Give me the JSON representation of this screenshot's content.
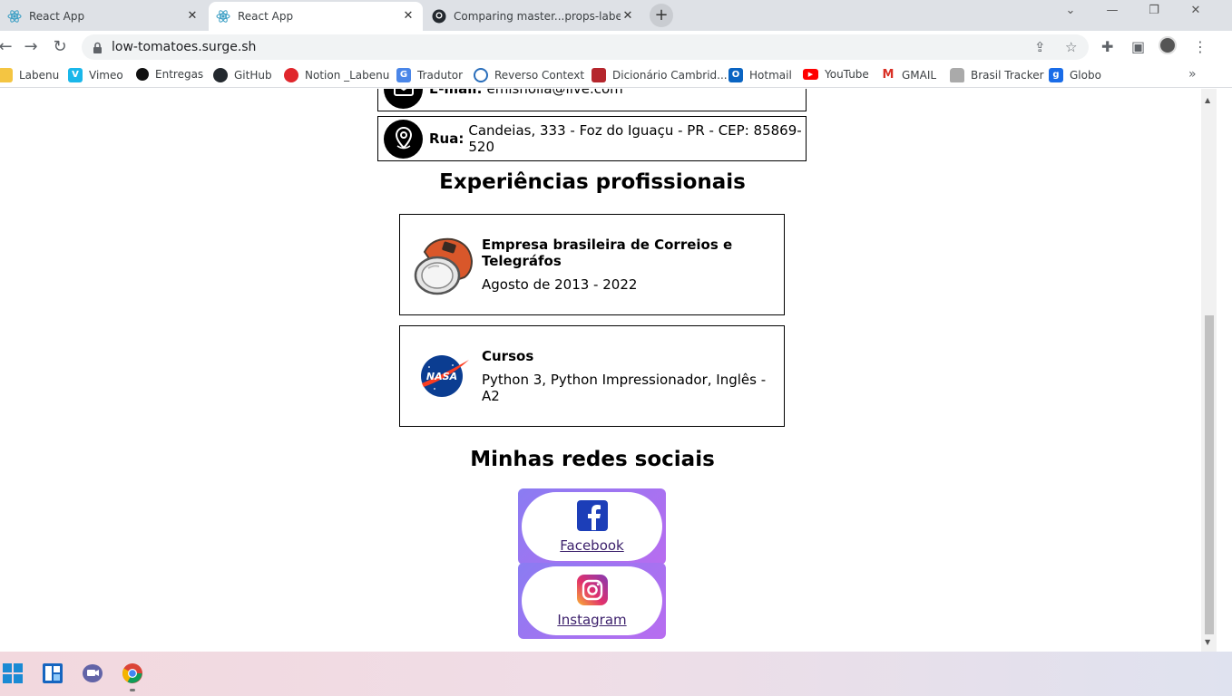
{
  "browser": {
    "tabs": [
      {
        "title": "React App",
        "active": false
      },
      {
        "title": "React App",
        "active": true
      },
      {
        "title": "Comparing master...props-labedi",
        "active": false
      }
    ],
    "url": "low-tomatoes.surge.sh",
    "bookmarks": [
      {
        "label": "Labenu",
        "icon": "folder-icon"
      },
      {
        "label": "Vimeo",
        "icon": "vimeo-icon"
      },
      {
        "label": "Entregas",
        "icon": "circle-icon"
      },
      {
        "label": "GitHub",
        "icon": "github-icon"
      },
      {
        "label": "Notion _Labenu",
        "icon": "apple-icon"
      },
      {
        "label": "Tradutor",
        "icon": "translate-icon"
      },
      {
        "label": "Reverso Context",
        "icon": "reverso-icon"
      },
      {
        "label": "Dicionário Cambrid...",
        "icon": "cambridge-icon"
      },
      {
        "label": "Hotmail",
        "icon": "outlook-icon"
      },
      {
        "label": "YouTube",
        "icon": "youtube-icon"
      },
      {
        "label": "GMAIL",
        "icon": "gmail-icon"
      },
      {
        "label": "Brasil Tracker",
        "icon": "lock-icon"
      },
      {
        "label": "Globo",
        "icon": "globo-icon"
      }
    ],
    "bookmarks_more": "»"
  },
  "page": {
    "email": {
      "label": "E-mail:",
      "value": "emisholia@live.com"
    },
    "address": {
      "label": "Rua:",
      "value": "Candeias, 333 - Foz do Iguaçu - PR - CEP: 85869-520"
    },
    "experience_title": "Experiências profissionais",
    "experiences": [
      {
        "title": "Empresa brasileira de Correios e Telegráfos",
        "subtitle": "Agosto de 2013 - 2022",
        "logo": "astronaut-helmet-icon"
      },
      {
        "title": "Cursos",
        "subtitle": "Python 3, Python Impressionador, Inglês - A2",
        "logo": "nasa-logo"
      }
    ],
    "social_title": "Minhas redes sociais",
    "social": [
      {
        "label": "Facebook",
        "icon": "facebook-icon"
      },
      {
        "label": "Instagram",
        "icon": "instagram-icon"
      }
    ]
  },
  "colors": {
    "social_gradient_start": "#8a7cf2",
    "social_gradient_end": "#b86cf0",
    "link": "#3b1f6b"
  }
}
